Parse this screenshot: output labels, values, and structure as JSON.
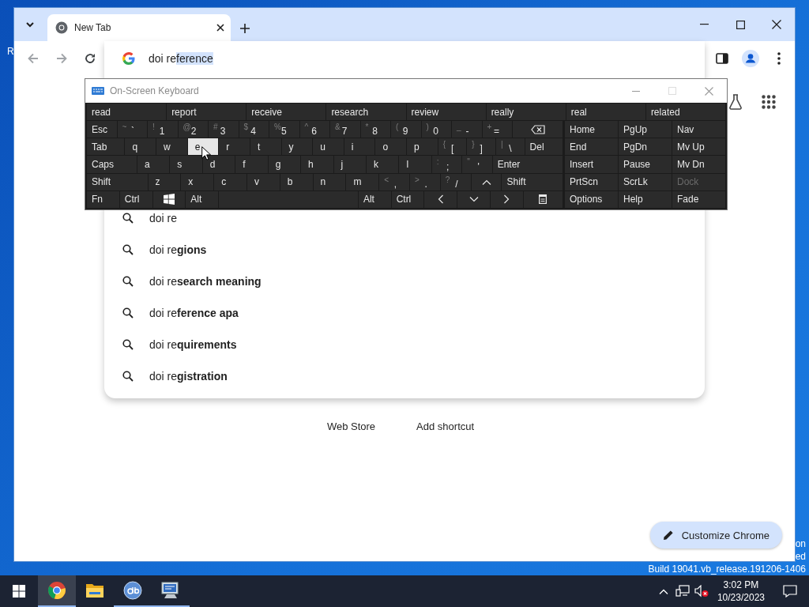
{
  "browser": {
    "tabs": [
      {
        "title": "New Tab",
        "selected": true
      }
    ],
    "omnibox": {
      "typed": "doi re",
      "completion": "ference"
    },
    "suggestions": [
      {
        "text": "doi re"
      },
      {
        "text": "doi re**gions**"
      },
      {
        "text": "doi re**search meaning**"
      },
      {
        "text": "doi re**ference apa**"
      },
      {
        "text": "doi re**quirements**"
      },
      {
        "text": "doi re**gistration**"
      }
    ],
    "shortcuts": [
      {
        "label": "Web Store"
      },
      {
        "label": "Add shortcut"
      }
    ],
    "customize_button": "Customize Chrome"
  },
  "keyboard": {
    "title": "On-Screen Keyboard",
    "predictions": [
      "read",
      "report",
      "receive",
      "research",
      "review",
      "really",
      "real",
      "related"
    ],
    "rows": [
      [
        {
          "kind": "text",
          "label": "Esc",
          "hover": false
        },
        {
          "kind": "char",
          "shift": "~",
          "label": "`",
          "hover": false
        },
        {
          "kind": "char",
          "shift": "!",
          "label": "1",
          "hover": false
        },
        {
          "kind": "char",
          "shift": "@",
          "label": "2",
          "hover": false
        },
        {
          "kind": "char",
          "shift": "#",
          "label": "3",
          "hover": false
        },
        {
          "kind": "char",
          "shift": "$",
          "label": "4",
          "hover": false
        },
        {
          "kind": "char",
          "shift": "%",
          "label": "5",
          "hover": false
        },
        {
          "kind": "char",
          "shift": "^",
          "label": "6",
          "hover": false
        },
        {
          "kind": "char",
          "shift": "&",
          "label": "7",
          "hover": false
        },
        {
          "kind": "char",
          "shift": "*",
          "label": "8",
          "hover": false
        },
        {
          "kind": "char",
          "shift": "(",
          "label": "9",
          "hover": false
        },
        {
          "kind": "char",
          "shift": ")",
          "label": "0",
          "hover": false
        },
        {
          "kind": "char",
          "shift": "_",
          "label": "-",
          "hover": false
        },
        {
          "kind": "char",
          "shift": "+",
          "label": "=",
          "hover": false
        },
        {
          "kind": "backspace",
          "hover": false
        }
      ],
      [
        {
          "kind": "text",
          "label": "Tab",
          "hover": false
        },
        {
          "kind": "letter",
          "label": "q",
          "hover": false
        },
        {
          "kind": "letter",
          "label": "w",
          "hover": false
        },
        {
          "kind": "letter",
          "label": "e",
          "hover": true
        },
        {
          "kind": "letter",
          "label": "r",
          "hover": false
        },
        {
          "kind": "letter",
          "label": "t",
          "hover": false
        },
        {
          "kind": "letter",
          "label": "y",
          "hover": false
        },
        {
          "kind": "letter",
          "label": "u",
          "hover": false
        },
        {
          "kind": "letter",
          "label": "i",
          "hover": false
        },
        {
          "kind": "letter",
          "label": "o",
          "hover": false
        },
        {
          "kind": "letter",
          "label": "p",
          "hover": false
        },
        {
          "kind": "char",
          "shift": "{",
          "label": "[",
          "hover": false
        },
        {
          "kind": "char",
          "shift": "}",
          "label": "]",
          "hover": false
        },
        {
          "kind": "char",
          "shift": "|",
          "label": "\\",
          "hover": false
        },
        {
          "kind": "text",
          "label": "Del",
          "hover": false
        }
      ],
      [
        {
          "kind": "text",
          "label": "Caps",
          "hover": false
        },
        {
          "kind": "letter",
          "label": "a",
          "hover": false
        },
        {
          "kind": "letter",
          "label": "s",
          "hover": false
        },
        {
          "kind": "letter",
          "label": "d",
          "hover": false
        },
        {
          "kind": "letter",
          "label": "f",
          "hover": false
        },
        {
          "kind": "letter",
          "label": "g",
          "hover": false
        },
        {
          "kind": "letter",
          "label": "h",
          "hover": false
        },
        {
          "kind": "letter",
          "label": "j",
          "hover": false
        },
        {
          "kind": "letter",
          "label": "k",
          "hover": false
        },
        {
          "kind": "letter",
          "label": "l",
          "hover": false
        },
        {
          "kind": "char",
          "shift": ":",
          "label": ";",
          "hover": false
        },
        {
          "kind": "char",
          "shift": "\"",
          "label": "'",
          "hover": false
        },
        {
          "kind": "text",
          "label": "Enter",
          "hover": false
        }
      ],
      [
        {
          "kind": "text",
          "label": "Shift",
          "hover": false
        },
        {
          "kind": "letter",
          "label": "z",
          "hover": false
        },
        {
          "kind": "letter",
          "label": "x",
          "hover": false
        },
        {
          "kind": "letter",
          "label": "c",
          "hover": false
        },
        {
          "kind": "letter",
          "label": "v",
          "hover": false
        },
        {
          "kind": "letter",
          "label": "b",
          "hover": false
        },
        {
          "kind": "letter",
          "label": "n",
          "hover": false
        },
        {
          "kind": "letter",
          "label": "m",
          "hover": false
        },
        {
          "kind": "char",
          "shift": "<",
          "label": ",",
          "hover": false
        },
        {
          "kind": "char",
          "shift": ">",
          "label": ".",
          "hover": false
        },
        {
          "kind": "char",
          "shift": "?",
          "label": "/",
          "hover": false
        },
        {
          "kind": "up",
          "hover": false
        },
        {
          "kind": "text",
          "label": "Shift",
          "hover": false
        }
      ],
      [
        {
          "kind": "text",
          "label": "Fn",
          "hover": false
        },
        {
          "kind": "text",
          "label": "Ctrl",
          "hover": false
        },
        {
          "kind": "windows",
          "hover": false
        },
        {
          "kind": "text",
          "label": "Alt",
          "hover": false
        },
        {
          "kind": "space",
          "hover": false
        },
        {
          "kind": "text",
          "label": "Alt",
          "hover": false
        },
        {
          "kind": "text",
          "label": "Ctrl",
          "hover": false
        },
        {
          "kind": "left",
          "hover": false
        },
        {
          "kind": "down",
          "hover": false
        },
        {
          "kind": "right",
          "hover": false
        },
        {
          "kind": "menu",
          "hover": false
        }
      ]
    ],
    "nav": [
      [
        {
          "label": "Home",
          "disabled": false
        },
        {
          "label": "PgUp",
          "disabled": false
        },
        {
          "label": "Nav",
          "disabled": false
        }
      ],
      [
        {
          "label": "End",
          "disabled": false
        },
        {
          "label": "PgDn",
          "disabled": false
        },
        {
          "label": "Mv Up",
          "disabled": false
        }
      ],
      [
        {
          "label": "Insert",
          "disabled": false
        },
        {
          "label": "Pause",
          "disabled": false
        },
        {
          "label": "Mv Dn",
          "disabled": false
        }
      ],
      [
        {
          "label": "PrtScn",
          "disabled": false
        },
        {
          "label": "ScrLk",
          "disabled": false
        },
        {
          "label": "Dock",
          "disabled": true
        }
      ],
      [
        {
          "label": "Options",
          "disabled": false
        },
        {
          "label": "Help",
          "disabled": false
        },
        {
          "label": "Fade",
          "disabled": false
        }
      ]
    ]
  },
  "desktop": {
    "icon_label": "R",
    "watermark": [
      "on",
      "ed",
      "Build 19041.vb_release.191206-1406"
    ]
  },
  "taskbar": {
    "apps": [
      {
        "kind": "chrome",
        "active": true,
        "running": true
      },
      {
        "kind": "explorer",
        "active": false,
        "running": false
      },
      {
        "kind": "qbittorrent",
        "active": false,
        "running": true
      },
      {
        "kind": "remote",
        "active": false,
        "running": true
      }
    ],
    "time": "3:02 PM",
    "date": "10/23/2023"
  }
}
